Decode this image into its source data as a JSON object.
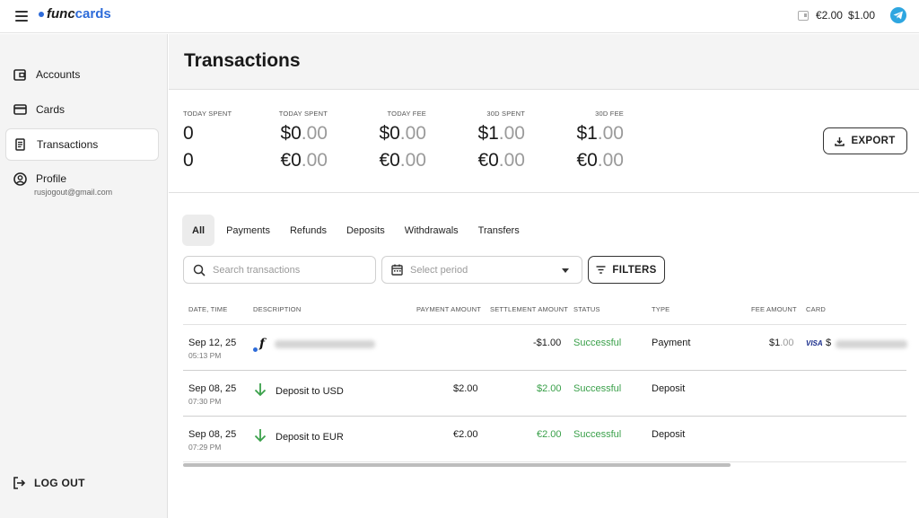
{
  "header": {
    "logo_func": "func",
    "logo_cards": "cards",
    "balance_eur": "€2.00",
    "balance_usd": "$1.00"
  },
  "sidebar": {
    "items": [
      {
        "label": "Accounts",
        "icon": "wallet-icon"
      },
      {
        "label": "Cards",
        "icon": "credit-card-icon"
      },
      {
        "label": "Transactions",
        "icon": "receipt-icon",
        "active": true
      },
      {
        "label": "Profile",
        "icon": "user-circle-icon"
      }
    ],
    "profile_email": "rusjogout@gmail.com",
    "logout_label": "LOG OUT"
  },
  "page": {
    "title": "Transactions"
  },
  "stats": {
    "columns": [
      {
        "label": "TODAY SPENT",
        "usd_main": "0",
        "usd_cents": "",
        "eur_main": "0",
        "eur_cents": ""
      },
      {
        "label": "TODAY SPENT",
        "usd_main": "$0",
        "usd_cents": ".00",
        "eur_main": "€0",
        "eur_cents": ".00"
      },
      {
        "label": "TODAY FEE",
        "usd_main": "$0",
        "usd_cents": ".00",
        "eur_main": "€0",
        "eur_cents": ".00"
      },
      {
        "label": "30D SPENT",
        "usd_main": "$1",
        "usd_cents": ".00",
        "eur_main": "€0",
        "eur_cents": ".00"
      },
      {
        "label": "30D FEE",
        "usd_main": "$1",
        "usd_cents": ".00",
        "eur_main": "€0",
        "eur_cents": ".00"
      }
    ],
    "export_label": "EXPORT"
  },
  "tabs": [
    "All",
    "Payments",
    "Refunds",
    "Deposits",
    "Withdrawals",
    "Transfers"
  ],
  "search": {
    "placeholder": "Search transactions"
  },
  "period": {
    "placeholder": "Select period"
  },
  "filters_label": "FILTERS",
  "table": {
    "headers": [
      "DATE, TIME",
      "DESCRIPTION",
      "PAYMENT AMOUNT",
      "SETTLEMENT AMOUNT",
      "STATUS",
      "TYPE",
      "FEE AMOUNT",
      "CARD"
    ],
    "rows": [
      {
        "date": "Sep 12, 25",
        "time": "05:13 PM",
        "description": "",
        "payment": "",
        "settlement": "-$1.00",
        "status": "Successful",
        "type": "Payment",
        "fee_main": "$1",
        "fee_cents": ".00",
        "card_brand": "VISA",
        "card_prefix": "$"
      },
      {
        "date": "Sep 08, 25",
        "time": "07:30 PM",
        "description": "Deposit to USD",
        "payment": "$2.00",
        "settlement": "$2.00",
        "status": "Successful",
        "type": "Deposit"
      },
      {
        "date": "Sep 08, 25",
        "time": "07:29 PM",
        "description": "Deposit to EUR",
        "payment": "€2.00",
        "settlement": "€2.00",
        "status": "Successful",
        "type": "Deposit"
      }
    ]
  },
  "colors": {
    "accent": "#2d6bd9",
    "success": "#3aa04a",
    "telegram": "#2ea6e0"
  }
}
